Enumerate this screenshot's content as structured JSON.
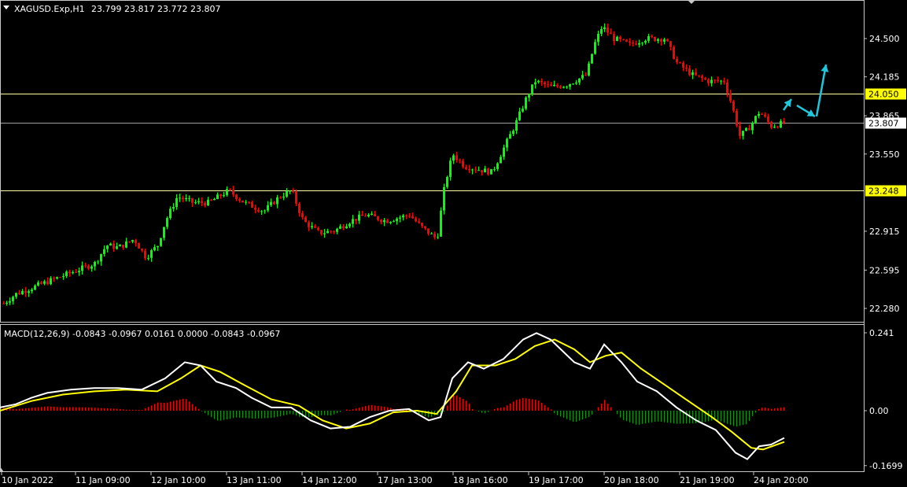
{
  "header": {
    "symbol": "XAGUSD.Exp,H1",
    "ohlc": "23.799 23.817 23.772 23.807"
  },
  "chart_data": [
    {
      "type": "candlestick",
      "y_ticks": [
        "24.500",
        "24.185",
        "23.865",
        "23.550",
        "22.915",
        "22.595",
        "22.280"
      ],
      "levels": [
        {
          "label": "24.050",
          "value": 24.05,
          "color": "#ffffa0",
          "text_color": "#000000"
        },
        {
          "label": "23.807",
          "value": 23.807,
          "color": "#a0a0a0",
          "text_color": "#000000",
          "style": "current-price"
        },
        {
          "label": "23.248",
          "value": 23.248,
          "color": "#ffffa0",
          "text_color": "#000000"
        }
      ],
      "ylim": [
        22.2,
        24.7
      ],
      "x_ticks": [
        "10 Jan 2022",
        "11 Jan 09:00",
        "12 Jan 10:00",
        "13 Jan 11:00",
        "14 Jan 12:00",
        "17 Jan 13:00",
        "18 Jan 16:00",
        "19 Jan 17:00",
        "20 Jan 18:00",
        "21 Jan 19:00",
        "24 Jan 20:00"
      ],
      "bull_color": "#00ff00",
      "bear_color": "#ff0000",
      "close_path": [
        [
          0,
          22.3
        ],
        [
          20,
          22.4
        ],
        [
          40,
          22.45
        ],
        [
          60,
          22.5
        ],
        [
          80,
          22.55
        ],
        [
          100,
          22.6
        ],
        [
          120,
          22.65
        ],
        [
          135,
          22.8
        ],
        [
          150,
          22.78
        ],
        [
          170,
          22.85
        ],
        [
          185,
          22.7
        ],
        [
          200,
          22.8
        ],
        [
          210,
          23.0
        ],
        [
          225,
          23.2
        ],
        [
          245,
          23.15
        ],
        [
          265,
          23.15
        ],
        [
          290,
          23.25
        ],
        [
          310,
          23.15
        ],
        [
          335,
          23.08
        ],
        [
          355,
          23.2
        ],
        [
          370,
          23.25
        ],
        [
          385,
          23.0
        ],
        [
          405,
          22.9
        ],
        [
          425,
          22.92
        ],
        [
          445,
          23.0
        ],
        [
          465,
          23.05
        ],
        [
          490,
          23.0
        ],
        [
          520,
          23.05
        ],
        [
          535,
          22.95
        ],
        [
          555,
          22.85
        ],
        [
          565,
          23.3
        ],
        [
          575,
          23.55
        ],
        [
          590,
          23.45
        ],
        [
          610,
          23.42
        ],
        [
          625,
          23.4
        ],
        [
          640,
          23.6
        ],
        [
          655,
          23.8
        ],
        [
          668,
          24.0
        ],
        [
          680,
          24.15
        ],
        [
          700,
          24.1
        ],
        [
          720,
          24.12
        ],
        [
          745,
          24.2
        ],
        [
          755,
          24.45
        ],
        [
          765,
          24.6
        ],
        [
          780,
          24.5
        ],
        [
          800,
          24.45
        ],
        [
          820,
          24.5
        ],
        [
          845,
          24.5
        ],
        [
          860,
          24.3
        ],
        [
          880,
          24.2
        ],
        [
          900,
          24.15
        ],
        [
          920,
          24.15
        ],
        [
          930,
          23.95
        ],
        [
          940,
          23.7
        ],
        [
          950,
          23.75
        ],
        [
          965,
          23.9
        ],
        [
          980,
          23.78
        ],
        [
          997,
          23.807
        ]
      ]
    },
    {
      "type": "macd",
      "label": "MACD(12,26,9) -0.0843 -0.0967 0.0161 0.0000 -0.0843 -0.0967",
      "y_ticks": [
        "0.241",
        "0.00",
        "-0.1699"
      ],
      "ylim": [
        -0.1699,
        0.241
      ],
      "macd_color": "#ffffff",
      "signal_color": "#ffff00",
      "hist_pos_color": "#ff0000",
      "hist_neg_color": "#00a000",
      "macd": [
        [
          0,
          0.01
        ],
        [
          20,
          0.02
        ],
        [
          40,
          0.04
        ],
        [
          60,
          0.055
        ],
        [
          90,
          0.065
        ],
        [
          120,
          0.07
        ],
        [
          150,
          0.07
        ],
        [
          180,
          0.065
        ],
        [
          210,
          0.1
        ],
        [
          235,
          0.15
        ],
        [
          255,
          0.14
        ],
        [
          275,
          0.09
        ],
        [
          300,
          0.07
        ],
        [
          320,
          0.04
        ],
        [
          345,
          0.01
        ],
        [
          370,
          0.01
        ],
        [
          395,
          -0.03
        ],
        [
          420,
          -0.055
        ],
        [
          445,
          -0.05
        ],
        [
          470,
          -0.02
        ],
        [
          495,
          0.0
        ],
        [
          520,
          0.005
        ],
        [
          545,
          -0.03
        ],
        [
          560,
          -0.02
        ],
        [
          575,
          0.1
        ],
        [
          595,
          0.15
        ],
        [
          615,
          0.13
        ],
        [
          640,
          0.16
        ],
        [
          665,
          0.22
        ],
        [
          682,
          0.24
        ],
        [
          700,
          0.22
        ],
        [
          730,
          0.15
        ],
        [
          750,
          0.13
        ],
        [
          768,
          0.205
        ],
        [
          790,
          0.15
        ],
        [
          810,
          0.09
        ],
        [
          835,
          0.06
        ],
        [
          860,
          0.01
        ],
        [
          885,
          -0.03
        ],
        [
          910,
          -0.06
        ],
        [
          935,
          -0.13
        ],
        [
          950,
          -0.15
        ],
        [
          965,
          -0.11
        ],
        [
          980,
          -0.105
        ],
        [
          997,
          -0.0843
        ]
      ],
      "signal": [
        [
          0,
          0.0
        ],
        [
          40,
          0.03
        ],
        [
          80,
          0.05
        ],
        [
          120,
          0.06
        ],
        [
          160,
          0.065
        ],
        [
          200,
          0.06
        ],
        [
          230,
          0.1
        ],
        [
          255,
          0.14
        ],
        [
          280,
          0.12
        ],
        [
          310,
          0.08
        ],
        [
          345,
          0.035
        ],
        [
          380,
          0.015
        ],
        [
          410,
          -0.03
        ],
        [
          440,
          -0.055
        ],
        [
          470,
          -0.04
        ],
        [
          500,
          -0.005
        ],
        [
          530,
          0.0
        ],
        [
          555,
          -0.01
        ],
        [
          580,
          0.06
        ],
        [
          600,
          0.14
        ],
        [
          630,
          0.14
        ],
        [
          655,
          0.16
        ],
        [
          680,
          0.2
        ],
        [
          705,
          0.22
        ],
        [
          730,
          0.19
        ],
        [
          750,
          0.15
        ],
        [
          770,
          0.17
        ],
        [
          790,
          0.18
        ],
        [
          815,
          0.13
        ],
        [
          845,
          0.08
        ],
        [
          875,
          0.03
        ],
        [
          905,
          -0.02
        ],
        [
          930,
          -0.065
        ],
        [
          955,
          -0.115
        ],
        [
          970,
          -0.12
        ],
        [
          997,
          -0.0967
        ]
      ]
    }
  ]
}
